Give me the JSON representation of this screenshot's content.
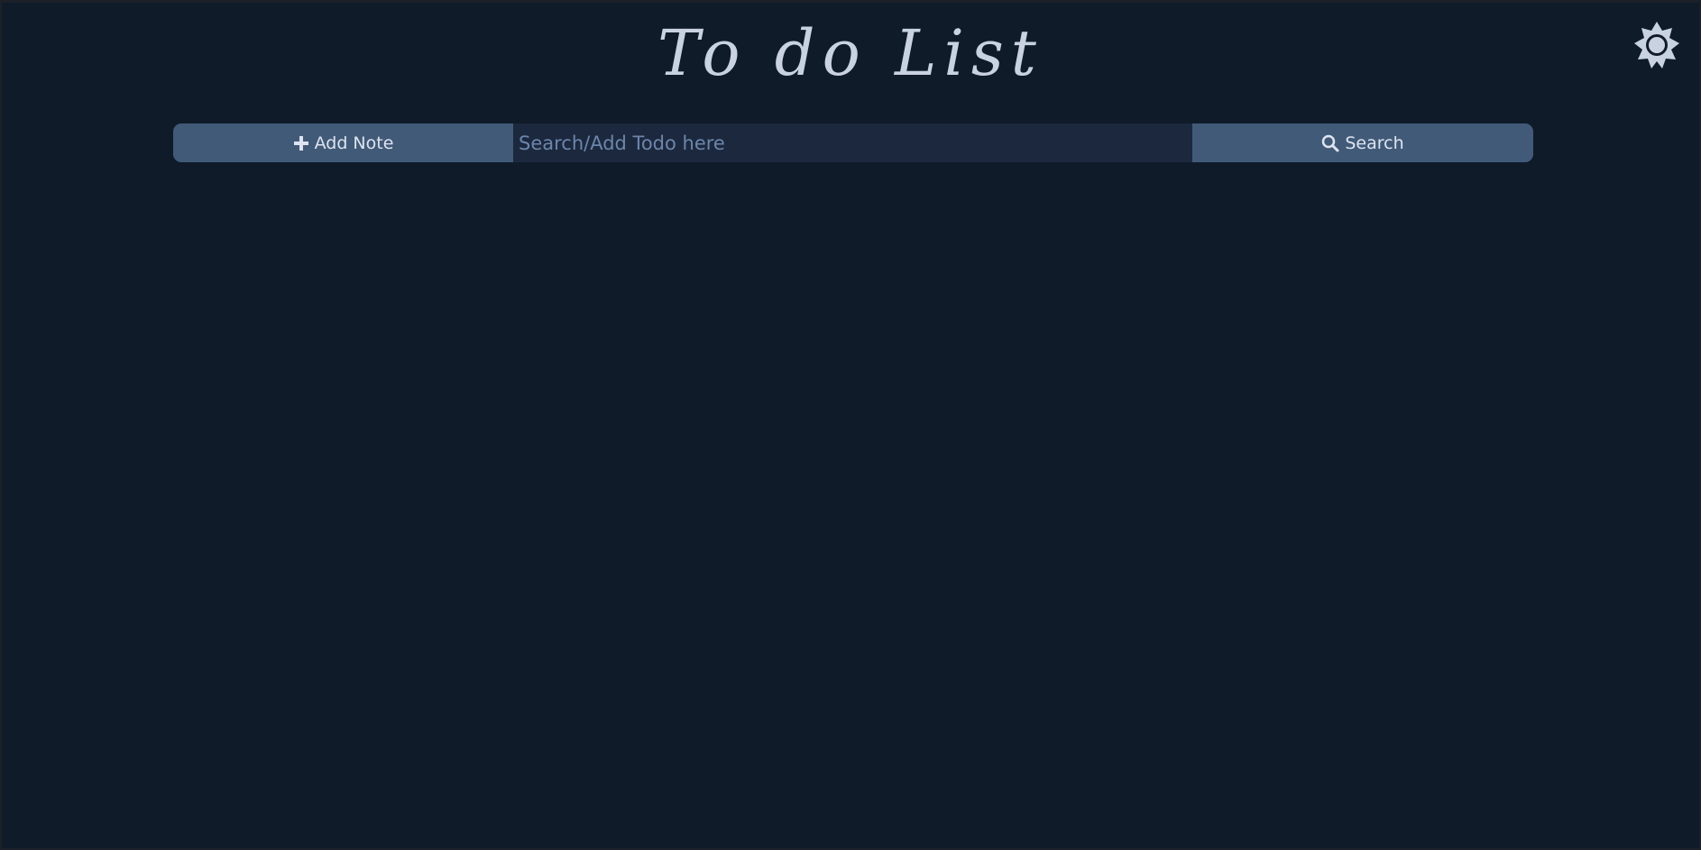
{
  "app": {
    "title": "To do List"
  },
  "toolbar": {
    "add_label": "Add Note",
    "search_placeholder": "Search/Add Todo here",
    "search_value": "",
    "search_label": "Search"
  },
  "icons": {
    "theme": "sun-icon",
    "add": "plus-icon",
    "search": "magnifier-icon"
  },
  "colors": {
    "background": "#0f1b29",
    "button": "#415a78",
    "input": "#1c283d",
    "text": "#c9d2e0",
    "placeholder": "#6c86ab"
  }
}
